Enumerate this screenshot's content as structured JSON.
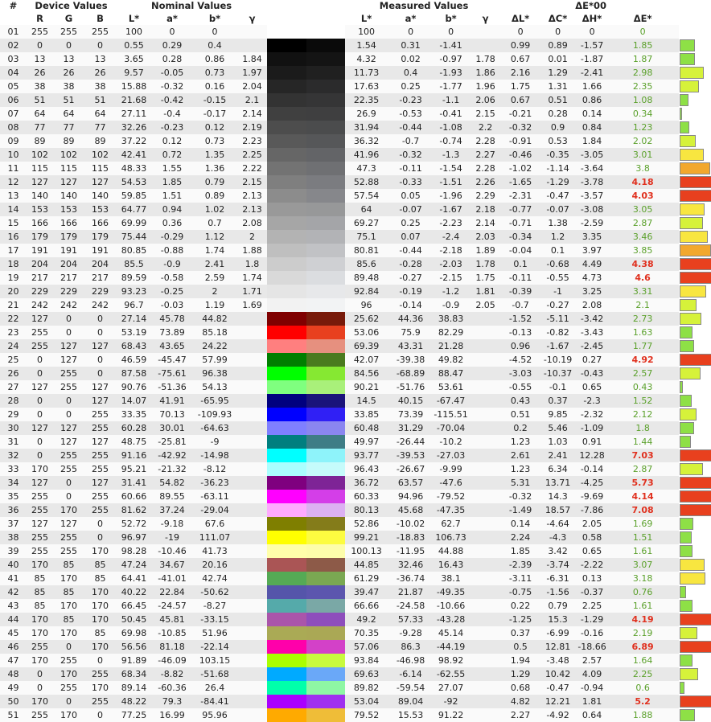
{
  "headers": {
    "num": "#",
    "device": "Device Values",
    "nominal": "Nominal Values",
    "measured": "Measured Values",
    "de00": "ΔE*00",
    "R": "R",
    "G": "G",
    "B": "B",
    "L": "L*",
    "a": "a*",
    "b": "b*",
    "gamma": "γ",
    "dL": "ΔL*",
    "dC": "ΔC*",
    "dH": "ΔH*",
    "dE": "ΔE*"
  },
  "rows": [
    [
      "01",
      "255",
      "255",
      "255",
      "100",
      "0",
      "0",
      "",
      "100",
      "0",
      "0",
      "",
      "0",
      "0",
      "0",
      "0",
      "#ffffff",
      "#ffffff"
    ],
    [
      "02",
      "0",
      "0",
      "0",
      "0.55",
      "0.29",
      "0.4",
      "",
      "1.54",
      "0.31",
      "-1.41",
      "",
      "0.99",
      "0.89",
      "-1.57",
      "1.85",
      "#000000",
      "#0a0a0a"
    ],
    [
      "03",
      "13",
      "13",
      "13",
      "3.65",
      "0.28",
      "0.86",
      "1.84",
      "4.32",
      "0.02",
      "-0.97",
      "1.78",
      "0.67",
      "0.01",
      "-1.87",
      "1.87",
      "#111111",
      "#141414"
    ],
    [
      "04",
      "26",
      "26",
      "26",
      "9.57",
      "-0.05",
      "0.73",
      "1.97",
      "11.73",
      "0.4",
      "-1.93",
      "1.86",
      "2.16",
      "1.29",
      "-2.41",
      "2.98",
      "#1b1b1b",
      "#202020"
    ],
    [
      "05",
      "38",
      "38",
      "38",
      "15.88",
      "-0.32",
      "0.16",
      "2.04",
      "17.63",
      "0.25",
      "-1.77",
      "1.96",
      "1.75",
      "1.31",
      "1.66",
      "2.35",
      "#262626",
      "#2b2b2c"
    ],
    [
      "06",
      "51",
      "51",
      "51",
      "21.68",
      "-0.42",
      "-0.15",
      "2.1",
      "22.35",
      "-0.23",
      "-1.1",
      "2.06",
      "0.67",
      "0.51",
      "0.86",
      "1.08",
      "#333333",
      "#353536"
    ],
    [
      "07",
      "64",
      "64",
      "64",
      "27.11",
      "-0.4",
      "-0.17",
      "2.14",
      "26.9",
      "-0.53",
      "-0.41",
      "2.15",
      "-0.21",
      "0.28",
      "0.14",
      "0.34",
      "#404040",
      "#3f3f40"
    ],
    [
      "08",
      "77",
      "77",
      "77",
      "32.26",
      "-0.23",
      "0.12",
      "2.19",
      "31.94",
      "-0.44",
      "-1.08",
      "2.2",
      "-0.32",
      "0.9",
      "0.84",
      "1.23",
      "#4d4d4d",
      "#4b4c4d"
    ],
    [
      "09",
      "89",
      "89",
      "89",
      "37.22",
      "0.12",
      "0.73",
      "2.23",
      "36.32",
      "-0.7",
      "-0.74",
      "2.28",
      "-0.91",
      "0.53",
      "1.84",
      "2.02",
      "#595959",
      "#565759"
    ],
    [
      "10",
      "102",
      "102",
      "102",
      "42.41",
      "0.72",
      "1.35",
      "2.25",
      "41.96",
      "-0.32",
      "-1.3",
      "2.27",
      "-0.46",
      "-0.35",
      "-3.05",
      "3.01",
      "#666666",
      "#636467"
    ],
    [
      "11",
      "115",
      "115",
      "115",
      "48.33",
      "1.55",
      "1.36",
      "2.22",
      "47.3",
      "-0.11",
      "-1.54",
      "2.28",
      "-1.02",
      "-1.14",
      "-3.64",
      "3.8",
      "#737373",
      "#6f7073"
    ],
    [
      "12",
      "127",
      "127",
      "127",
      "54.53",
      "1.85",
      "0.79",
      "2.15",
      "52.88",
      "-0.33",
      "-1.51",
      "2.26",
      "-1.65",
      "-1.29",
      "-3.78",
      "4.18",
      "#7f7f7f",
      "#7b7c80"
    ],
    [
      "13",
      "140",
      "140",
      "140",
      "59.85",
      "1.51",
      "0.89",
      "2.13",
      "57.54",
      "0.05",
      "-1.96",
      "2.29",
      "-2.31",
      "-0.47",
      "-3.57",
      "4.03",
      "#8c8c8c",
      "#86878b"
    ],
    [
      "14",
      "153",
      "153",
      "153",
      "64.77",
      "0.94",
      "1.02",
      "2.13",
      "64",
      "-0.07",
      "-1.67",
      "2.18",
      "-0.77",
      "-0.07",
      "-3.08",
      "3.05",
      "#999999",
      "#979899"
    ],
    [
      "15",
      "166",
      "166",
      "166",
      "69.99",
      "0.36",
      "0.7",
      "2.08",
      "69.27",
      "0.25",
      "-2.23",
      "2.14",
      "-0.71",
      "1.38",
      "-2.59",
      "2.87",
      "#a6a6a6",
      "#a4a5a8"
    ],
    [
      "16",
      "179",
      "179",
      "179",
      "75.44",
      "-0.29",
      "1.12",
      "2",
      "75.1",
      "0.07",
      "-2.4",
      "2.03",
      "-0.34",
      "1.2",
      "3.35",
      "3.46",
      "#b3b3b3",
      "#b2b3b6"
    ],
    [
      "17",
      "191",
      "191",
      "191",
      "80.85",
      "-0.88",
      "1.74",
      "1.88",
      "80.81",
      "-0.44",
      "-2.18",
      "1.89",
      "-0.04",
      "0.1",
      "3.97",
      "3.85",
      "#bfbfbf",
      "#c1c2c5"
    ],
    [
      "18",
      "204",
      "204",
      "204",
      "85.5",
      "-0.9",
      "2.41",
      "1.8",
      "85.6",
      "-0.28",
      "-2.03",
      "1.78",
      "0.1",
      "-0.68",
      "4.49",
      "4.38",
      "#cccccc",
      "#cfd0d3"
    ],
    [
      "19",
      "217",
      "217",
      "217",
      "89.59",
      "-0.58",
      "2.59",
      "1.74",
      "89.48",
      "-0.27",
      "-2.15",
      "1.75",
      "-0.11",
      "-0.55",
      "4.73",
      "4.6",
      "#d9d9d9",
      "#dbdde0"
    ],
    [
      "20",
      "229",
      "229",
      "229",
      "93.23",
      "-0.25",
      "2",
      "1.71",
      "92.84",
      "-0.19",
      "-1.2",
      "1.81",
      "-0.39",
      "-1",
      "3.25",
      "3.31",
      "#e5e5e5",
      "#e7e8ea"
    ],
    [
      "21",
      "242",
      "242",
      "242",
      "96.7",
      "-0.03",
      "1.19",
      "1.69",
      "96",
      "-0.14",
      "-0.9",
      "2.05",
      "-0.7",
      "-0.27",
      "2.08",
      "2.1",
      "#f2f2f2",
      "#f2f3f4"
    ],
    [
      "22",
      "127",
      "0",
      "0",
      "27.14",
      "45.78",
      "44.82",
      "",
      "25.62",
      "44.36",
      "38.83",
      "",
      "-1.52",
      "-5.11",
      "-3.42",
      "2.73",
      "#7f0000",
      "#781a0a"
    ],
    [
      "23",
      "255",
      "0",
      "0",
      "53.19",
      "73.89",
      "85.18",
      "",
      "53.06",
      "75.9",
      "82.29",
      "",
      "-0.13",
      "-0.82",
      "-3.43",
      "1.63",
      "#ff0000",
      "#e8401f"
    ],
    [
      "24",
      "255",
      "127",
      "127",
      "68.43",
      "43.65",
      "24.22",
      "",
      "69.39",
      "43.31",
      "21.28",
      "",
      "0.96",
      "-1.67",
      "-2.45",
      "1.77",
      "#ff7f7f",
      "#e6907f"
    ],
    [
      "25",
      "0",
      "127",
      "0",
      "46.59",
      "-45.47",
      "57.99",
      "",
      "42.07",
      "-39.38",
      "49.82",
      "",
      "-4.52",
      "-10.19",
      "0.27",
      "4.92",
      "#007f00",
      "#4a7a1e"
    ],
    [
      "26",
      "0",
      "255",
      "0",
      "87.58",
      "-75.61",
      "96.38",
      "",
      "84.56",
      "-68.89",
      "88.47",
      "",
      "-3.03",
      "-10.37",
      "-0.43",
      "2.57",
      "#00ff00",
      "#86e832"
    ],
    [
      "27",
      "127",
      "255",
      "127",
      "90.76",
      "-51.36",
      "54.13",
      "",
      "90.21",
      "-51.76",
      "53.61",
      "",
      "-0.55",
      "-0.1",
      "0.65",
      "0.43",
      "#7fff7f",
      "#a9f07a"
    ],
    [
      "28",
      "0",
      "0",
      "127",
      "14.07",
      "41.91",
      "-65.95",
      "",
      "14.5",
      "40.15",
      "-67.47",
      "",
      "0.43",
      "0.37",
      "-2.3",
      "1.52",
      "#00007f",
      "#1a137a"
    ],
    [
      "29",
      "0",
      "0",
      "255",
      "33.35",
      "70.13",
      "-109.93",
      "",
      "33.85",
      "73.39",
      "-115.51",
      "",
      "0.51",
      "9.85",
      "-2.32",
      "2.12",
      "#0000ff",
      "#3020f5"
    ],
    [
      "30",
      "127",
      "127",
      "255",
      "60.28",
      "30.01",
      "-64.63",
      "",
      "60.48",
      "31.29",
      "-70.04",
      "",
      "0.2",
      "5.46",
      "-1.09",
      "1.8",
      "#7f7fff",
      "#8a86f0"
    ],
    [
      "31",
      "0",
      "127",
      "127",
      "48.75",
      "-25.81",
      "-9",
      "",
      "49.97",
      "-26.44",
      "-10.2",
      "",
      "1.23",
      "1.03",
      "0.91",
      "1.44",
      "#007f7f",
      "#3e7d86"
    ],
    [
      "32",
      "0",
      "255",
      "255",
      "91.16",
      "-42.92",
      "-14.98",
      "",
      "93.77",
      "-39.53",
      "-27.03",
      "",
      "2.61",
      "2.41",
      "12.28",
      "7.03",
      "#00ffff",
      "#8ef3fa"
    ],
    [
      "33",
      "170",
      "255",
      "255",
      "95.21",
      "-21.32",
      "-8.12",
      "",
      "96.43",
      "-26.67",
      "-9.99",
      "",
      "1.23",
      "6.34",
      "-0.14",
      "2.87",
      "#aaffff",
      "#c6fbfb"
    ],
    [
      "34",
      "127",
      "0",
      "127",
      "31.41",
      "54.82",
      "-36.23",
      "",
      "36.72",
      "63.57",
      "-47.6",
      "",
      "5.31",
      "13.71",
      "-4.25",
      "5.73",
      "#7f007f",
      "#7e2496"
    ],
    [
      "35",
      "255",
      "0",
      "255",
      "60.66",
      "89.55",
      "-63.11",
      "",
      "60.33",
      "94.96",
      "-79.52",
      "",
      "-0.32",
      "14.3",
      "-9.69",
      "4.14",
      "#ff00ff",
      "#d43ee8"
    ],
    [
      "36",
      "255",
      "170",
      "255",
      "81.62",
      "37.24",
      "-29.04",
      "",
      "80.13",
      "45.68",
      "-47.35",
      "",
      "-1.49",
      "18.57",
      "-7.86",
      "7.08",
      "#ffaaff",
      "#dcb1f2"
    ],
    [
      "37",
      "127",
      "127",
      "0",
      "52.72",
      "-9.18",
      "67.6",
      "",
      "52.86",
      "-10.02",
      "62.7",
      "",
      "0.14",
      "-4.64",
      "2.05",
      "1.69",
      "#7f7f00",
      "#847c1a"
    ],
    [
      "38",
      "255",
      "255",
      "0",
      "96.97",
      "-19",
      "111.07",
      "",
      "99.21",
      "-18.83",
      "106.73",
      "",
      "2.24",
      "-4.3",
      "0.58",
      "1.51",
      "#ffff00",
      "#fcfc40"
    ],
    [
      "39",
      "255",
      "255",
      "170",
      "98.28",
      "-10.46",
      "41.73",
      "",
      "100.13",
      "-11.95",
      "44.88",
      "",
      "1.85",
      "3.42",
      "0.65",
      "1.61",
      "#ffffaa",
      "#fdfdaa"
    ],
    [
      "40",
      "170",
      "85",
      "85",
      "47.24",
      "34.67",
      "20.16",
      "",
      "44.85",
      "32.46",
      "16.43",
      "",
      "-2.39",
      "-3.74",
      "-2.22",
      "3.07",
      "#aa5555",
      "#8d5a48"
    ],
    [
      "41",
      "85",
      "170",
      "85",
      "64.41",
      "-41.01",
      "42.74",
      "",
      "61.29",
      "-36.74",
      "38.1",
      "",
      "-3.11",
      "-6.31",
      "0.13",
      "3.18",
      "#55aa55",
      "#7aa852"
    ],
    [
      "42",
      "85",
      "85",
      "170",
      "40.22",
      "22.84",
      "-50.62",
      "",
      "39.47",
      "21.87",
      "-49.35",
      "",
      "-0.75",
      "-1.56",
      "-0.37",
      "0.76",
      "#5555aa",
      "#5c56ae"
    ],
    [
      "43",
      "85",
      "170",
      "170",
      "66.45",
      "-24.57",
      "-8.27",
      "",
      "66.66",
      "-24.58",
      "-10.66",
      "",
      "0.22",
      "0.79",
      "2.25",
      "1.61",
      "#55aaaa",
      "#7aa8a6"
    ],
    [
      "44",
      "170",
      "85",
      "170",
      "50.45",
      "45.81",
      "-33.15",
      "",
      "49.2",
      "57.33",
      "-43.28",
      "",
      "-1.25",
      "15.3",
      "-1.29",
      "4.19",
      "#aa55aa",
      "#8e4ebc"
    ],
    [
      "45",
      "170",
      "170",
      "85",
      "69.98",
      "-10.85",
      "51.96",
      "",
      "70.35",
      "-9.28",
      "45.14",
      "",
      "0.37",
      "-6.99",
      "-0.16",
      "2.19",
      "#aaaa55",
      "#aaa855"
    ],
    [
      "46",
      "255",
      "0",
      "170",
      "56.56",
      "81.18",
      "-22.14",
      "",
      "57.06",
      "86.3",
      "-44.19",
      "",
      "0.5",
      "12.81",
      "-18.66",
      "6.89",
      "#ff00aa",
      "#d341c8"
    ],
    [
      "47",
      "170",
      "255",
      "0",
      "91.89",
      "-46.09",
      "103.15",
      "",
      "93.84",
      "-46.98",
      "98.92",
      "",
      "1.94",
      "-3.48",
      "2.57",
      "1.64",
      "#aaff00",
      "#c8fa3e"
    ],
    [
      "48",
      "0",
      "170",
      "255",
      "68.34",
      "-8.82",
      "-51.68",
      "",
      "69.63",
      "-6.14",
      "-62.55",
      "",
      "1.29",
      "10.42",
      "4.09",
      "2.25",
      "#00aaff",
      "#6aa8f8"
    ],
    [
      "49",
      "0",
      "255",
      "170",
      "89.14",
      "-60.36",
      "26.4",
      "",
      "89.82",
      "-59.54",
      "27.07",
      "",
      "0.68",
      "-0.47",
      "-0.94",
      "0.6",
      "#00ffaa",
      "#8ef7a4"
    ],
    [
      "50",
      "170",
      "0",
      "255",
      "48.22",
      "79.3",
      "-84.41",
      "",
      "53.04",
      "89.04",
      "-92",
      "",
      "4.82",
      "12.21",
      "1.81",
      "5.2",
      "#aa00ff",
      "#a030ef"
    ],
    [
      "51",
      "255",
      "170",
      "0",
      "77.25",
      "16.99",
      "95.96",
      "",
      "79.52",
      "15.53",
      "91.22",
      "",
      "2.27",
      "-4.92",
      "0.64",
      "1.88",
      "#ffaa00",
      "#efbd38"
    ]
  ],
  "de_colors": {
    "good": "#5aa02a",
    "bad": "#e0301e"
  }
}
